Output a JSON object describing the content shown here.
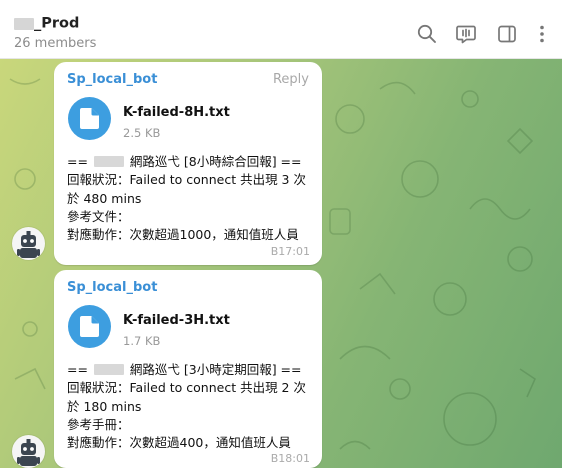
{
  "header": {
    "title": "_Prod",
    "members": "26 members",
    "icons": [
      "search-icon",
      "video-chat-icon",
      "sidebar-toggle-icon",
      "more-vertical-icon"
    ]
  },
  "messages": [
    {
      "sender": "Sp_local_bot",
      "reply": "Reply",
      "file_name": "K-failed-8H.txt",
      "file_size": "2.5 KB",
      "line1_prefix": "== ",
      "line1_suffix": " 網路巡弋 [8小時綜合回報] ==",
      "line2": "回報狀況：Failed to connect 共出現 3 次",
      "line3": "於 480 mins",
      "line4": "參考文件：",
      "line5": "對應動作：次數超過1000，通知值班人員",
      "time": "B17:01"
    },
    {
      "sender": "Sp_local_bot",
      "file_name": "K-failed-3H.txt",
      "file_size": "1.7 KB",
      "line1_prefix": "== ",
      "line1_suffix": " 網路巡弋 [3小時定期回報] ==",
      "line2": "回報狀況：Failed to connect 共出現 2 次",
      "line3": "於 180 mins",
      "line4": "參考手冊：",
      "line5": "對應動作：次數超過400，通知值班人員",
      "time": "B18:01"
    }
  ],
  "colors": {
    "accent": "#3d9ee0",
    "sender": "#3a8fd6",
    "background_start": "#c9d77b",
    "background_end": "#6fa86f"
  }
}
